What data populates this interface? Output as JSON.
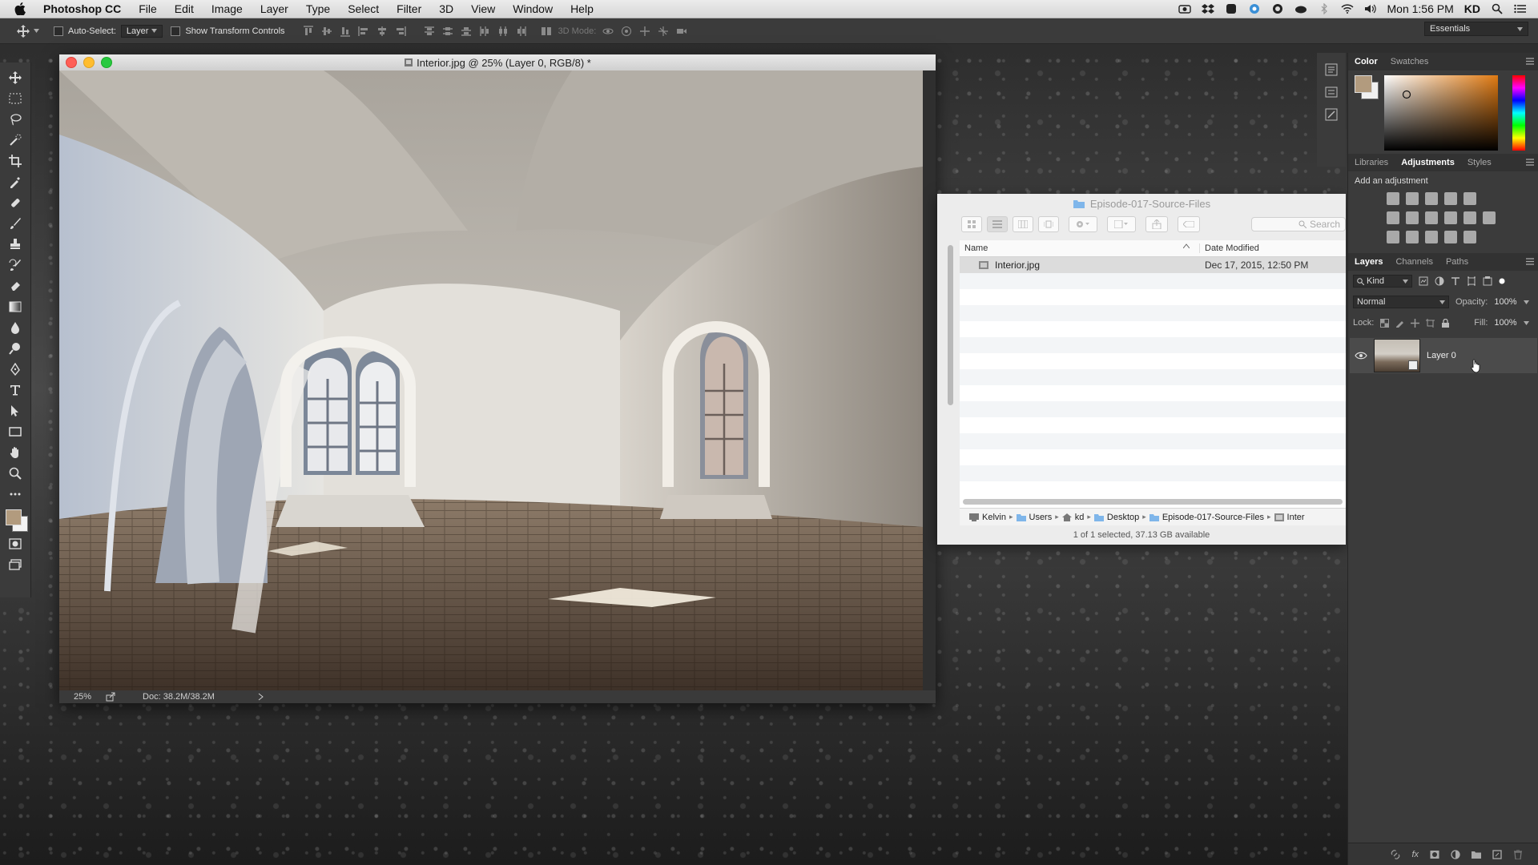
{
  "menubar": {
    "app_name": "Photoshop CC",
    "items": [
      "File",
      "Edit",
      "Image",
      "Layer",
      "Type",
      "Select",
      "Filter",
      "3D",
      "View",
      "Window",
      "Help"
    ],
    "clock": "Mon 1:56 PM",
    "user": "KD"
  },
  "options": {
    "auto_select_label": "Auto-Select:",
    "auto_select_value": "Layer",
    "transform_label": "Show Transform Controls",
    "mode_label": "3D Mode:",
    "workspace": "Essentials"
  },
  "document": {
    "title": "Interior.jpg @ 25% (Layer 0, RGB/8) *",
    "zoom": "25%",
    "doc_size": "Doc: 38.2M/38.2M"
  },
  "finder": {
    "title": "Episode-017-Source-Files",
    "search_placeholder": "Search",
    "col_name": "Name",
    "col_date": "Date Modified",
    "files": [
      {
        "name": "Interior.jpg",
        "date": "Dec 17, 2015, 12:50 PM"
      }
    ],
    "path": [
      "Kelvin",
      "Users",
      "kd",
      "Desktop",
      "Episode-017-Source-Files",
      "Inter"
    ],
    "status": "1 of 1 selected, 37.13 GB available"
  },
  "panels": {
    "color_tabs": [
      "Color",
      "Swatches"
    ],
    "adj_tabs": [
      "Libraries",
      "Adjustments",
      "Styles"
    ],
    "adj_label": "Add an adjustment",
    "layers_tabs": [
      "Layers",
      "Channels",
      "Paths"
    ],
    "kind": "Kind",
    "blend": "Normal",
    "opacity_label": "Opacity:",
    "opacity": "100%",
    "lock_label": "Lock:",
    "fill_label": "Fill:",
    "fill": "100%",
    "layer_name": "Layer 0"
  }
}
